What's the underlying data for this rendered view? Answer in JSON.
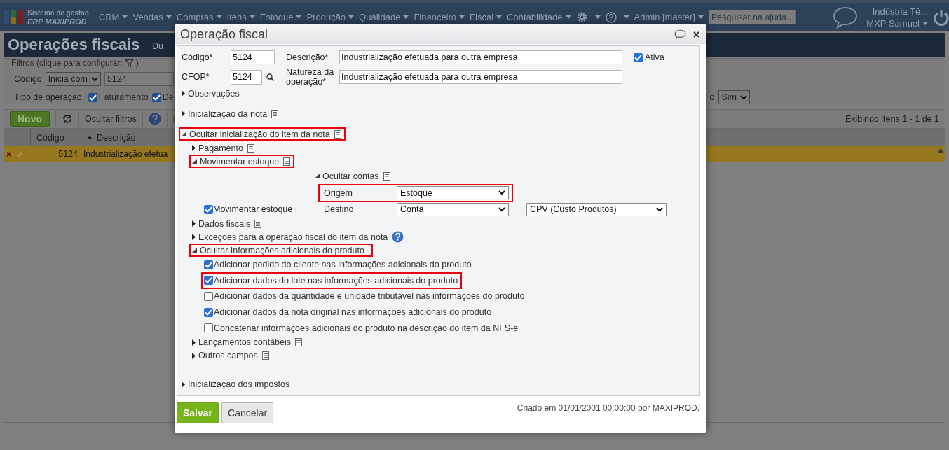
{
  "app": {
    "logo_line1": "Sistema de gestão",
    "logo_line2": "ERP MAXIPROD"
  },
  "nav": {
    "menus": [
      "CRM",
      "Vendas",
      "Compras",
      "Itens",
      "Estoque",
      "Produção",
      "Qualidade",
      "Financeiro",
      "Fiscal",
      "Contabilidade"
    ],
    "user_menu": "Admin [master]",
    "search": {
      "placeholder": "Pesquisar na ajuda..."
    },
    "company": "Indústria Tê...",
    "user": "MXP Samuel"
  },
  "page": {
    "title": "Operações fiscais",
    "title_tab": "Du",
    "filters": {
      "legend": "Filtros (clique para configurar:",
      "legend_end": ")",
      "code_label": "Código",
      "code_mode": "Inicia com",
      "code_value": "5124",
      "type_label": "Tipo de operação",
      "types": [
        {
          "label": "Faturamento",
          "checked": true
        },
        {
          "label": "De",
          "checked": true
        }
      ],
      "right_label": "o",
      "right_value": "Sim"
    },
    "toolbar": {
      "new_button": "Novo",
      "hide_filters": "Ocultar filtros",
      "paging": "Exibindo itens 1 - 1 de 1"
    },
    "table": {
      "columns": [
        {
          "label": "Código",
          "sorted": false
        },
        {
          "label": "Descrição",
          "sorted": true
        }
      ],
      "rows": [
        {
          "cells": [
            "5124",
            "Industrialização efetua"
          ],
          "selected": true
        }
      ]
    }
  },
  "modal": {
    "title": "Operação fiscal",
    "fields": {
      "code": {
        "label": "Código*",
        "value": "5124"
      },
      "cfop": {
        "label": "CFOP*",
        "value": "5124"
      },
      "description": {
        "label": "Descrição*",
        "value": "Industrialização efetuada para outra empresa"
      },
      "nature": {
        "label": "Natureza da operação*",
        "value": "Industrialização efetuada para outra empresa"
      },
      "active": {
        "label": "Ativa",
        "checked": true
      }
    },
    "sections": [
      {
        "kind": "plain",
        "label": "Observações",
        "expanded": false,
        "highlighted": false
      },
      {
        "kind": "documented",
        "label": "Inicialização da nota",
        "expanded": false,
        "highlighted": false
      },
      {
        "kind": "group",
        "label": "Ocultar inicialização do item da nota",
        "expanded": true,
        "highlighted": true,
        "children": [
          {
            "kind": "documented",
            "label": "Pagamento",
            "expanded": false,
            "highlighted": false
          },
          {
            "kind": "stock",
            "label": "Movimentar estoque",
            "expanded": true,
            "highlighted": true,
            "accounts": {
              "label": "Ocultar contas",
              "expanded": true
            },
            "origin": {
              "label": "Origem",
              "value": "Estoque",
              "highlighted": true
            },
            "move": {
              "label": "Movimentar estoque",
              "checked": true
            },
            "destination": {
              "label": "Destino",
              "value": "Conta",
              "account": "CPV (Custo Produtos)"
            }
          },
          {
            "kind": "documented",
            "label": "Dados fiscais",
            "expanded": false,
            "highlighted": false
          },
          {
            "kind": "help",
            "label": "Exceções para a operação fiscal do item da nota",
            "expanded": false,
            "highlighted": false
          },
          {
            "kind": "checklist",
            "label": "Ocultar Informações adicionais do produto",
            "expanded": true,
            "highlighted": true,
            "items": [
              {
                "label": "Adicionar pedido do cliente nas informações adicionais do produto",
                "checked": true,
                "highlighted": false
              },
              {
                "label": "Adicionar dados do lote nas informações adicionais do produto",
                "checked": true,
                "highlighted": true
              },
              {
                "label": "Adicionar dados da quantidade e unidade tributável nas informações do produto",
                "checked": false,
                "highlighted": false
              },
              {
                "label": "Adicionar dados da nota original nas informações adicionais do produto",
                "checked": true,
                "highlighted": false
              },
              {
                "label": "Concatenar informações adicionais do produto na descrição do item da NFS-e",
                "checked": false,
                "highlighted": false
              }
            ]
          },
          {
            "kind": "documented",
            "label": "Lançamentos contábeis",
            "expanded": false,
            "highlighted": false
          },
          {
            "kind": "documented",
            "label": "Outros campos",
            "expanded": false,
            "highlighted": false
          }
        ]
      },
      {
        "kind": "plain",
        "label": "Inicialização dos impostos",
        "expanded": false,
        "highlighted": false
      }
    ],
    "buttons": [
      {
        "label": "Salvar",
        "kind": "primary"
      },
      {
        "label": "Cancelar",
        "kind": "secondary"
      }
    ],
    "created": "Criado em 01/01/2001 00:00:00 por MAXIPROD."
  }
}
